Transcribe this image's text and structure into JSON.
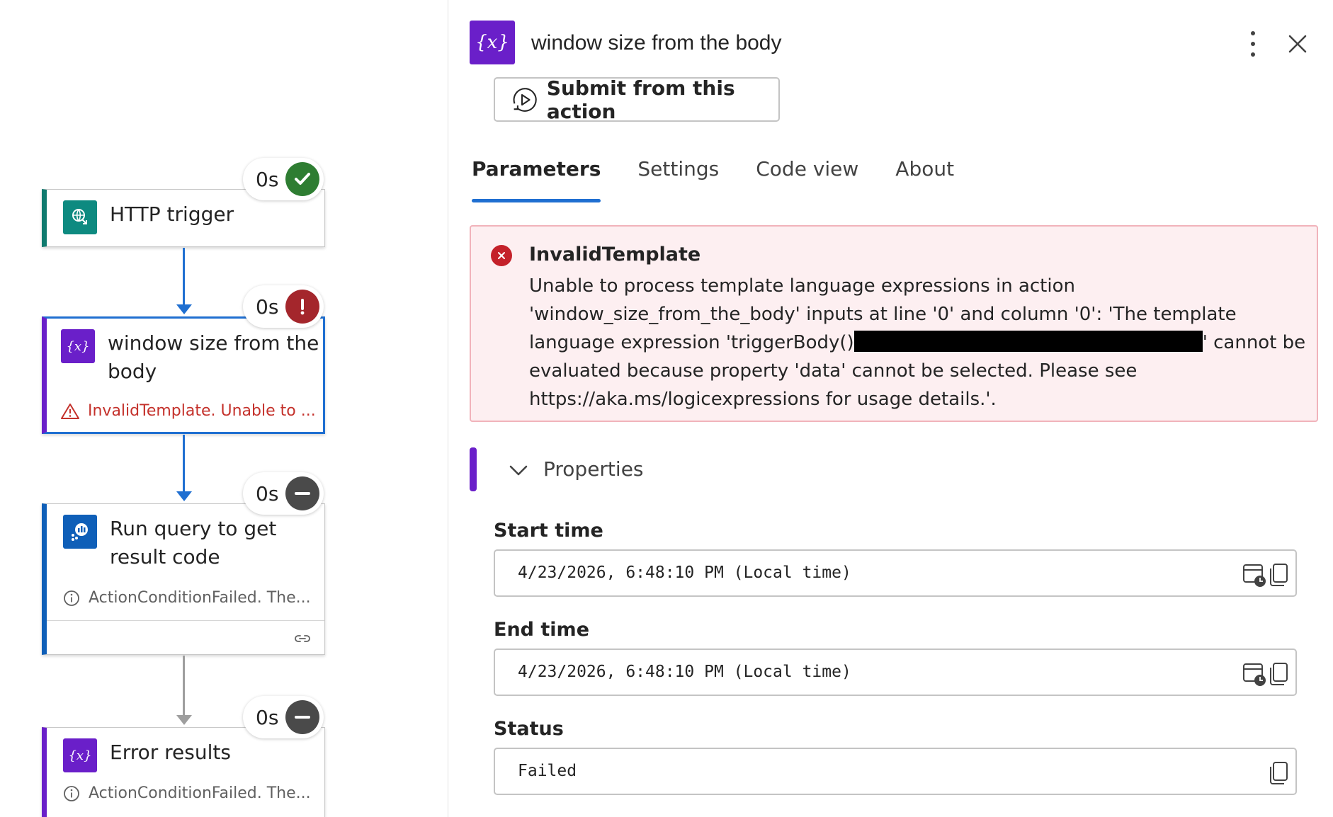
{
  "canvas": {
    "nodes": [
      {
        "title": "HTTP trigger",
        "duration": "0s",
        "status": "succeeded",
        "icon": "http-trigger-icon",
        "accent": "#0f7a6e"
      },
      {
        "title": "window size from the body",
        "duration": "0s",
        "status": "failed",
        "icon": "variable-icon",
        "accent": "#6a1fc9",
        "message": "InvalidTemplate. Unable to ..."
      },
      {
        "title": "Run query to get result code",
        "duration": "0s",
        "status": "skipped",
        "icon": "query-icon",
        "accent": "#0f5fb8",
        "message": "ActionConditionFailed. The..."
      },
      {
        "title": "Error results",
        "duration": "0s",
        "status": "skipped",
        "icon": "variable-icon",
        "accent": "#6a1fc9",
        "message": "ActionConditionFailed. The..."
      }
    ]
  },
  "panel": {
    "title": "window size from the body",
    "submit_label": "Submit from this action",
    "tabs": [
      {
        "label": "Parameters",
        "active": true
      },
      {
        "label": "Settings",
        "active": false
      },
      {
        "label": "Code view",
        "active": false
      },
      {
        "label": "About",
        "active": false
      }
    ],
    "error": {
      "title": "InvalidTemplate",
      "message_part1": "Unable to process template language expressions in action 'window_size_from_the_body' inputs at line '0' and column '0': 'The template language expression 'triggerBody()",
      "message_part2": "' cannot be evaluated because property 'data' cannot be selected. Please see https://aka.ms/logicexpressions for usage details.'."
    },
    "properties_label": "Properties",
    "fields": {
      "start_time": {
        "label": "Start time",
        "value": "4/23/2026, 6:48:10 PM (Local time)"
      },
      "end_time": {
        "label": "End time",
        "value": "4/23/2026, 6:48:10 PM (Local time)"
      },
      "status": {
        "label": "Status",
        "value": "Failed"
      }
    }
  },
  "colors": {
    "success": "#2e7d32",
    "error": "#a4262c",
    "skipped": "#4a4a4a",
    "selected_border": "#1f6fd1",
    "variable_purple": "#6a1fc9",
    "error_bg": "#fdeff1"
  }
}
